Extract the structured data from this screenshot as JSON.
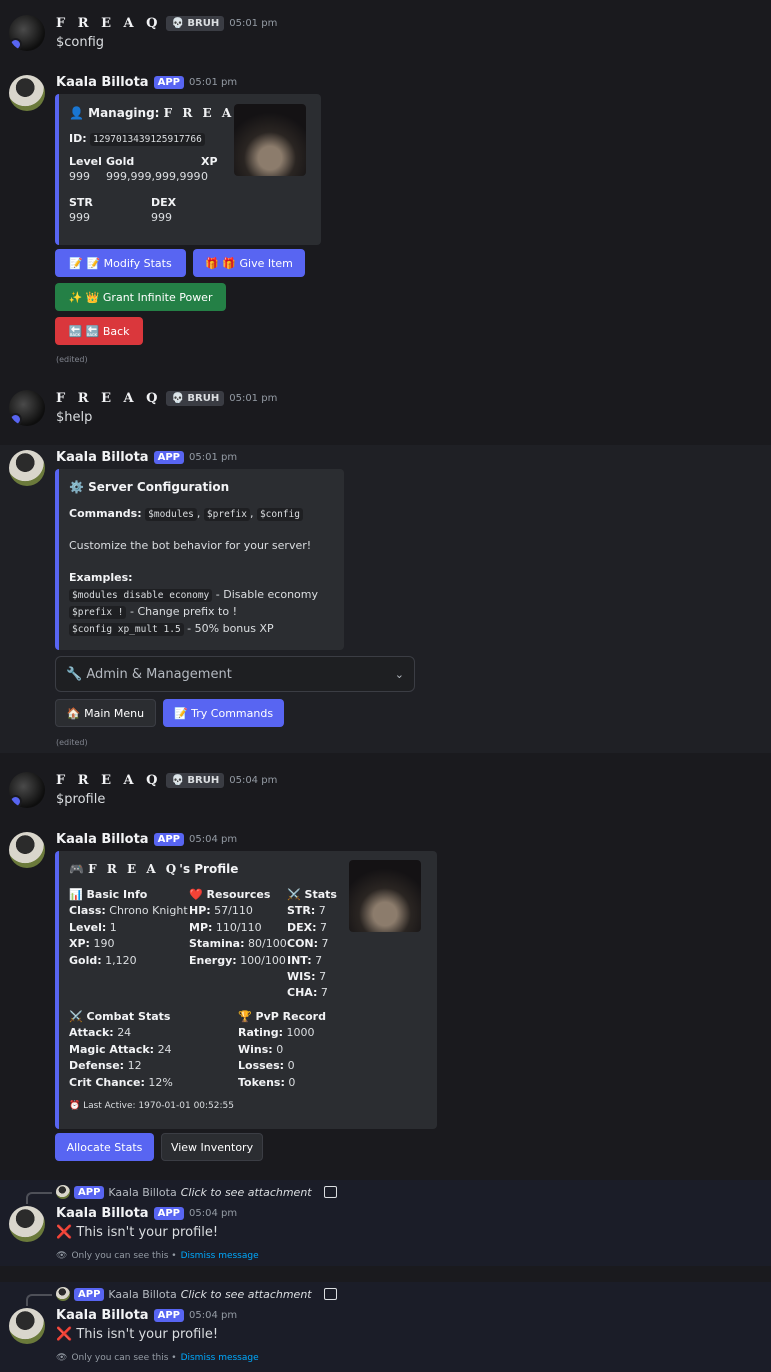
{
  "m1": {
    "author": "F R E A Q",
    "role": "💀 BRUH",
    "time": "05:01 pm",
    "text": "$config"
  },
  "m2": {
    "author": "Kaala Billota",
    "app": "APP",
    "time": "05:01 pm",
    "title_prefix": "Managing: ",
    "title_name": "F R E A Q",
    "id_label": "ID:",
    "id_value": "1297013439125917766",
    "level_label": "Level",
    "level_value": "999",
    "gold_label": "Gold",
    "gold_value": "999,999,999,999",
    "xp_label": "XP",
    "xp_value": "0",
    "str_label": "STR",
    "str_value": "999",
    "dex_label": "DEX",
    "dex_value": "999",
    "btn_modify": "📝 📝 Modify Stats",
    "btn_give": "🎁 🎁 Give Item",
    "btn_power": "✨ 👑 Grant Infinite Power",
    "btn_back": "🔙 🔙 Back",
    "edited": "(edited)"
  },
  "m3": {
    "author": "F R E A Q",
    "role": "💀 BRUH",
    "time": "05:01 pm",
    "text": "$help"
  },
  "m4": {
    "author": "Kaala Billota",
    "app": "APP",
    "time": "05:01 pm",
    "title": "Server Configuration",
    "commands_label": "Commands:",
    "cmd1": "$modules",
    "cmd2": "$prefix",
    "cmd3": "$config",
    "sep": ",",
    "desc": "Customize the bot behavior for your server!",
    "examples_label": "Examples:",
    "ex1_code": "$modules disable economy",
    "ex1_text": " - Disable economy",
    "ex2_code": "$prefix !",
    "ex2_text": " - Change prefix to !",
    "ex3_code": "$config xp_mult 1.5",
    "ex3_text": " - 50% bonus XP",
    "select": "🔧 Admin & Management",
    "btn_main": "🏠 Main Menu",
    "btn_try": "📝 Try Commands",
    "edited": "(edited)"
  },
  "m5": {
    "author": "F R E A Q",
    "role": "💀 BRUH",
    "time": "05:04 pm",
    "text": "$profile"
  },
  "m6": {
    "author": "Kaala Billota",
    "app": "APP",
    "time": "05:04 pm",
    "title_name": "F R E A Q",
    "title_suffix": "'s Profile",
    "basic": {
      "head": "Basic Info",
      "rows": [
        [
          "Class:",
          "Chrono Knight"
        ],
        [
          "Level:",
          "1"
        ],
        [
          "XP:",
          "190"
        ],
        [
          "Gold:",
          "1,120"
        ]
      ]
    },
    "res": {
      "head": "Resources",
      "rows": [
        [
          "HP:",
          "57/110"
        ],
        [
          "MP:",
          "110/110"
        ],
        [
          "Stamina:",
          "80/100"
        ],
        [
          "Energy:",
          "100/100"
        ]
      ]
    },
    "stats": {
      "head": "Stats",
      "rows": [
        [
          "STR:",
          "7"
        ],
        [
          "DEX:",
          "7"
        ],
        [
          "CON:",
          "7"
        ],
        [
          "INT:",
          "7"
        ],
        [
          "WIS:",
          "7"
        ],
        [
          "CHA:",
          "7"
        ]
      ]
    },
    "combat": {
      "head": "Combat Stats",
      "rows": [
        [
          "Attack:",
          "24"
        ],
        [
          "Magic Attack:",
          "24"
        ],
        [
          "Defense:",
          "12"
        ],
        [
          "Crit Chance:",
          "12%"
        ]
      ]
    },
    "pvp": {
      "head": "PvP Record",
      "rows": [
        [
          "Rating:",
          "1000"
        ],
        [
          "Wins:",
          "0"
        ],
        [
          "Losses:",
          "0"
        ],
        [
          "Tokens:",
          "0"
        ]
      ]
    },
    "last_active": "⏰ Last Active: 1970-01-01 00:52:55",
    "btn_alloc": "Allocate Stats",
    "btn_inv": "View Inventory"
  },
  "m7": {
    "reply_app": "APP",
    "reply_author": "Kaala Billota",
    "reply_text": "Click to see attachment",
    "author": "Kaala Billota",
    "app": "APP",
    "time": "05:04 pm",
    "text": "❌ This isn't your profile!",
    "only": "Only you can see this •",
    "dismiss": "Dismiss message"
  },
  "m8": {
    "reply_app": "APP",
    "reply_author": "Kaala Billota",
    "reply_text": "Click to see attachment",
    "author": "Kaala Billota",
    "app": "APP",
    "time": "05:04 pm",
    "text": "❌ This isn't your profile!",
    "only": "Only you can see this •",
    "dismiss": "Dismiss message"
  }
}
